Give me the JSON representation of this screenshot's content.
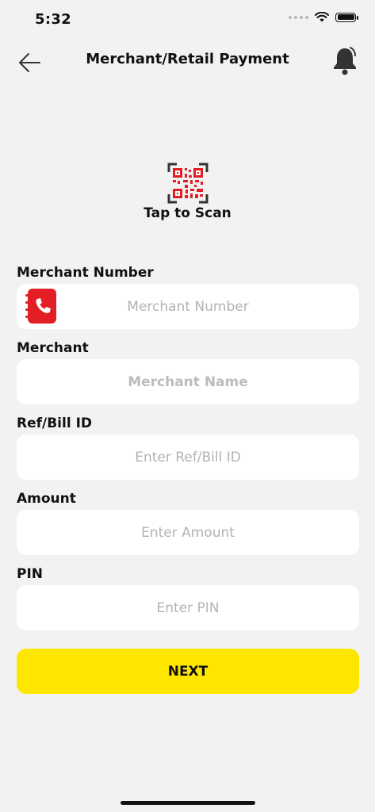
{
  "status_bar": {
    "time": "5:32"
  },
  "header": {
    "title": "Merchant/Retail Payment",
    "back_icon": "arrow-left",
    "bell_icon": "bell"
  },
  "scan": {
    "label": "Tap to Scan",
    "icon": "qr-code",
    "accent": "#e31e24"
  },
  "form": {
    "merchant_number": {
      "label": "Merchant Number",
      "placeholder": "Merchant Number",
      "value": ""
    },
    "merchant": {
      "label": "Merchant",
      "placeholder": "Merchant Name",
      "value": ""
    },
    "ref_bill": {
      "label": "Ref/Bill ID",
      "placeholder": "Enter Ref/Bill ID",
      "value": ""
    },
    "amount": {
      "label": "Amount",
      "placeholder": "Enter Amount",
      "value": ""
    },
    "pin": {
      "label": "PIN",
      "placeholder": "Enter PIN",
      "value": ""
    }
  },
  "next_button": {
    "label": "NEXT",
    "color": "#ffe600"
  },
  "colors": {
    "background": "#f2f2f2",
    "accent_red": "#e31e24",
    "primary_yellow": "#ffe600"
  }
}
